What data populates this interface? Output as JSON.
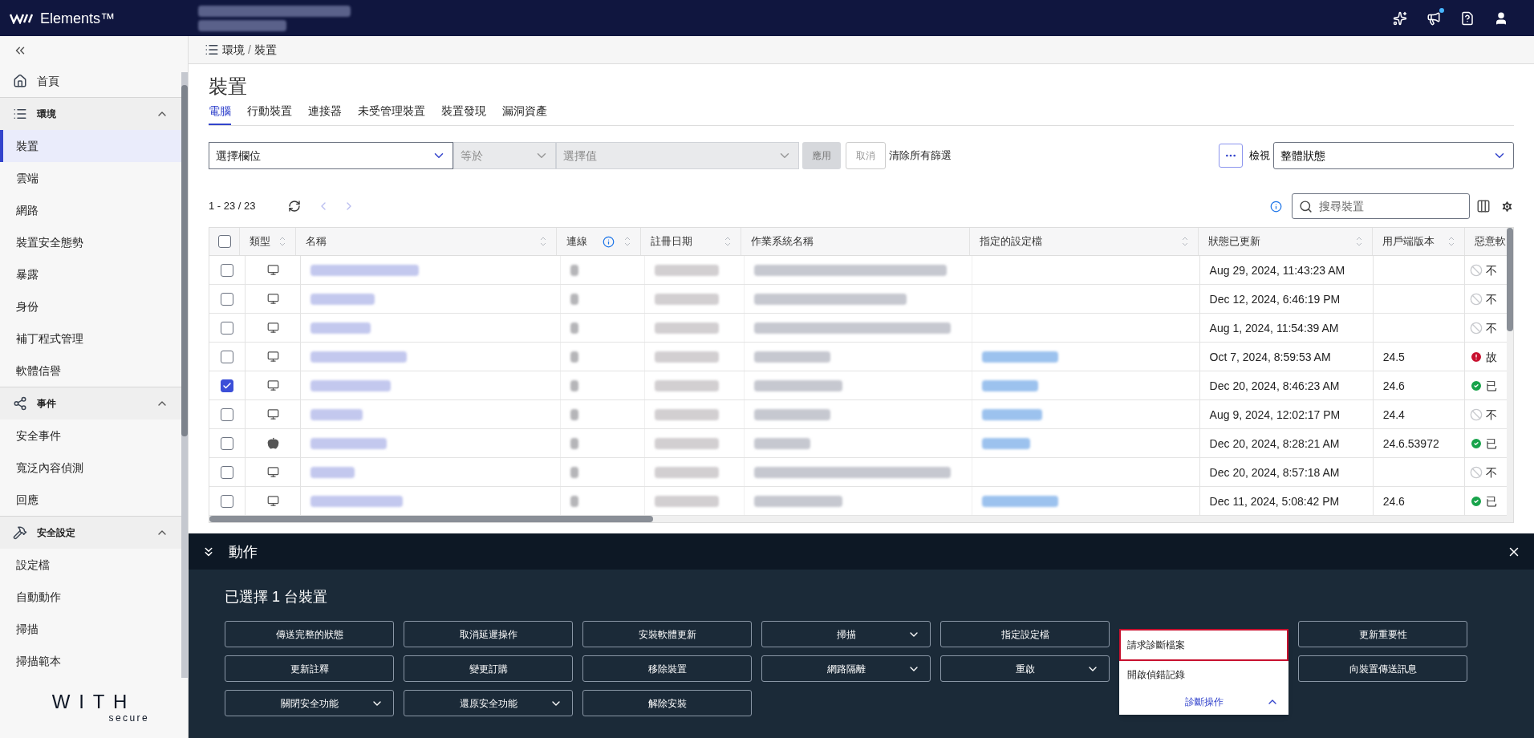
{
  "app": {
    "brand": "Elements™",
    "account_redacted": true
  },
  "sidebar": {
    "items": [
      {
        "kind": "link",
        "label": "首頁",
        "selected": false
      },
      {
        "kind": "section",
        "label": "環境",
        "expanded": true,
        "children": [
          {
            "label": "裝置",
            "selected": true
          },
          {
            "label": "雲端",
            "selected": false
          },
          {
            "label": "網路",
            "selected": false
          },
          {
            "label": "裝置安全態勢",
            "selected": false
          },
          {
            "label": "暴露",
            "selected": false
          },
          {
            "label": "身份",
            "selected": false
          },
          {
            "label": "補丁程式管理",
            "selected": false
          },
          {
            "label": "軟體信譽",
            "selected": false
          }
        ]
      },
      {
        "kind": "section",
        "label": "事件",
        "expanded": true,
        "children": [
          {
            "label": "安全事件",
            "selected": false
          },
          {
            "label": "寬泛內容偵測",
            "selected": false
          },
          {
            "label": "回應",
            "selected": false
          }
        ]
      },
      {
        "kind": "section",
        "label": "安全設定",
        "expanded": true,
        "children": [
          {
            "label": "設定檔",
            "selected": false
          },
          {
            "label": "自動動作",
            "selected": false
          },
          {
            "label": "掃描",
            "selected": false
          },
          {
            "label": "掃描範本",
            "selected": false
          }
        ]
      }
    ],
    "logo": {
      "word": "WITH",
      "sub": "secure"
    }
  },
  "breadcrumb": {
    "items": [
      "環境",
      "裝置"
    ],
    "separator": "/"
  },
  "page_title": "裝置",
  "tabs": [
    {
      "label": "電腦",
      "selected": true
    },
    {
      "label": "行動裝置",
      "selected": false
    },
    {
      "label": "連接器",
      "selected": false
    },
    {
      "label": "未受管理裝置",
      "selected": false
    },
    {
      "label": "裝置發現",
      "selected": false
    },
    {
      "label": "漏洞資產",
      "selected": false
    }
  ],
  "filter": {
    "field": {
      "placeholder": "選擇欄位",
      "disabled": false
    },
    "operator": {
      "placeholder": "等於",
      "disabled": true
    },
    "value": {
      "placeholder": "選擇值",
      "disabled": true
    },
    "apply": {
      "label": "應用",
      "disabled": true
    },
    "cancel": {
      "label": "取消",
      "disabled": true
    },
    "clear": "清除所有篩選"
  },
  "view": {
    "label": "檢視",
    "value": "整體狀態"
  },
  "pagination": "1 - 23 / 23",
  "search": {
    "placeholder": "搜尋裝置"
  },
  "table": {
    "select_all": false,
    "columns": [
      {
        "label": "類型",
        "sortable": true
      },
      {
        "label": "名稱",
        "sortable": true
      },
      {
        "label": "連線",
        "sortable": true,
        "info": true
      },
      {
        "label": "註冊日期",
        "sortable": true
      },
      {
        "label": "作業系統名稱",
        "sortable": false
      },
      {
        "label": "指定的設定檔",
        "sortable": true
      },
      {
        "label": "狀態已更新",
        "sortable": true
      },
      {
        "label": "用戶端版本",
        "sortable": true
      },
      {
        "label": "惡意軟",
        "sortable": false
      }
    ],
    "rows": [
      {
        "checked": false,
        "kind": "computer",
        "profile_redacted": false,
        "status_updated": "Aug 29, 2024, 11:43:23 AM",
        "malware": {
          "kind": "disabled",
          "label": "不"
        }
      },
      {
        "checked": false,
        "kind": "computer",
        "profile_redacted": false,
        "status_updated": "Dec 12, 2024, 6:46:19 PM",
        "malware": {
          "kind": "disabled",
          "label": "不"
        }
      },
      {
        "checked": false,
        "kind": "computer",
        "profile_redacted": false,
        "status_updated": "Aug 1, 2024, 11:54:39 AM",
        "malware": {
          "kind": "disabled",
          "label": "不"
        }
      },
      {
        "checked": false,
        "kind": "computer",
        "profile_redacted": true,
        "status_updated": "Oct 7, 2024, 8:59:53 AM",
        "client_version": "24.5",
        "malware": {
          "kind": "error",
          "label": "故"
        }
      },
      {
        "checked": true,
        "kind": "computer",
        "profile_redacted": true,
        "status_updated": "Dec 20, 2024, 8:46:23 AM",
        "client_version": "24.6",
        "malware": {
          "kind": "ok",
          "label": "已"
        }
      },
      {
        "checked": false,
        "kind": "computer",
        "profile_redacted": true,
        "status_updated": "Aug 9, 2024, 12:02:17 PM",
        "client_version": "24.4",
        "malware": {
          "kind": "disabled",
          "label": "不"
        }
      },
      {
        "checked": false,
        "kind": "apple",
        "profile_redacted": true,
        "status_updated": "Dec 20, 2024, 8:28:21 AM",
        "client_version": "24.6.53972",
        "malware": {
          "kind": "ok",
          "label": "已"
        }
      },
      {
        "checked": false,
        "kind": "computer",
        "profile_redacted": false,
        "status_updated": "Dec 20, 2024, 8:57:18 AM",
        "malware": {
          "kind": "disabled",
          "label": "不"
        }
      },
      {
        "checked": false,
        "kind": "computer",
        "profile_redacted": true,
        "status_updated": "Dec 11, 2024, 5:08:42 PM",
        "client_version": "24.6",
        "malware": {
          "kind": "ok",
          "label": "已"
        }
      }
    ]
  },
  "actions": {
    "title": "動作",
    "selection": "已選擇 1 台裝置",
    "columns": [
      [
        {
          "label": "傳送完整的狀態",
          "kind": "plain"
        },
        {
          "label": "更新註釋",
          "kind": "plain"
        },
        {
          "label": "關閉安全功能",
          "kind": "dropdown",
          "open": false
        }
      ],
      [
        {
          "label": "取消延遲操作",
          "kind": "plain"
        },
        {
          "label": "變更訂購",
          "kind": "plain"
        },
        {
          "label": "還原安全功能",
          "kind": "dropdown",
          "open": false
        }
      ],
      [
        {
          "label": "安裝軟體更新",
          "kind": "plain"
        },
        {
          "label": "移除裝置",
          "kind": "plain"
        },
        {
          "label": "解除安裝",
          "kind": "plain"
        }
      ],
      [
        {
          "label": "掃描",
          "kind": "dropdown",
          "open": false
        },
        {
          "label": "網路隔離",
          "kind": "dropdown",
          "open": false
        }
      ],
      [
        {
          "label": "指定設定檔",
          "kind": "plain"
        },
        {
          "label": "重啟",
          "kind": "dropdown",
          "open": false
        }
      ],
      [
        {
          "label": "診斷操作",
          "kind": "dropdown",
          "open": true,
          "menu": [
            {
              "label": "請求診斷檔案",
              "selected": true
            },
            {
              "label": "開啟偵錯記錄",
              "selected": false
            }
          ]
        }
      ],
      [
        {
          "label": "更新重要性",
          "kind": "plain"
        },
        {
          "label": "向裝置傳送訊息",
          "kind": "plain"
        }
      ]
    ]
  }
}
